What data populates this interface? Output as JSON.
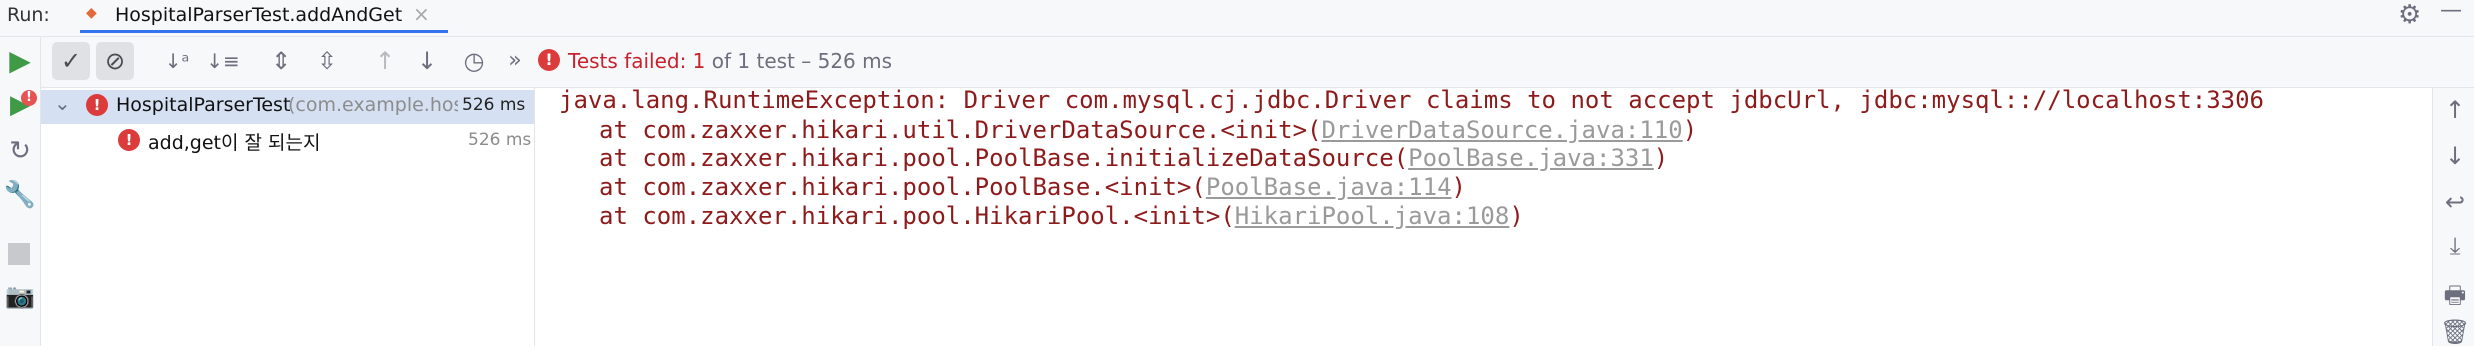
{
  "run_panel": {
    "label": "Run:",
    "tab_title": "HospitalParserTest.addAndGet",
    "tab_close": "×"
  },
  "status": {
    "prefix": "Tests failed: ",
    "failed_count": "1",
    "suffix": " of 1 test – 526 ms"
  },
  "tree": {
    "items": [
      {
        "name": "HospitalParserTest",
        "package": "(com.example.hospital)",
        "time": "526 ms",
        "expanded": true,
        "status": "failed"
      },
      {
        "name": "add,get이 잘 되는지",
        "time": "526 ms",
        "status": "failed"
      }
    ]
  },
  "console": {
    "exception": "java.lang.RuntimeException: Driver com.mysql.cj.jdbc.Driver claims to not accept jdbcUrl, jdbc:mysql:://localhost:3306",
    "frames": [
      {
        "prefix": "at com.zaxxer.hikari.util.DriverDataSource.<init>(",
        "link": "DriverDataSource.java:110",
        "suffix": ")"
      },
      {
        "prefix": "at com.zaxxer.hikari.pool.PoolBase.initializeDataSource(",
        "link": "PoolBase.java:331",
        "suffix": ")"
      },
      {
        "prefix": "at com.zaxxer.hikari.pool.PoolBase.<init>(",
        "link": "PoolBase.java:114",
        "suffix": ")"
      },
      {
        "prefix": "at com.zaxxer.hikari.pool.HikariPool.<init>(",
        "link": "HikariPool.java:108",
        "suffix": ")"
      }
    ]
  },
  "icons": {
    "error_mark": "!",
    "chevron": "⌄",
    "more": "»",
    "ok_check": "✓",
    "stop_circle": "⊘"
  },
  "colors": {
    "accent": "#3574f0",
    "error": "#db3b3b",
    "run_green": "#3f9a45",
    "selection": "#d5e1f3"
  }
}
